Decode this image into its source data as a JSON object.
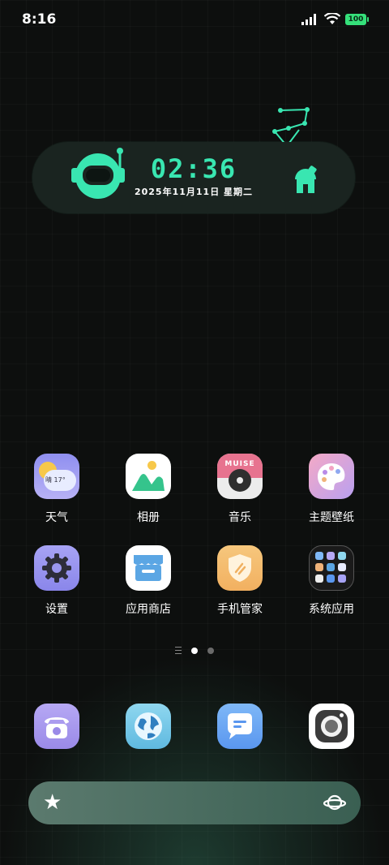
{
  "status_bar": {
    "time": "8:16",
    "battery": "100"
  },
  "clock_widget": {
    "time": "02:36",
    "date": "2025年11月11日 星期二"
  },
  "apps": [
    {
      "label": "天气",
      "icon": "weather-icon",
      "temp": "晴 17°"
    },
    {
      "label": "相册",
      "icon": "gallery-icon"
    },
    {
      "label": "音乐",
      "icon": "music-icon",
      "brand": "MUISE"
    },
    {
      "label": "主题壁纸",
      "icon": "theme-icon"
    },
    {
      "label": "设置",
      "icon": "settings-icon"
    },
    {
      "label": "应用商店",
      "icon": "app-store-icon"
    },
    {
      "label": "手机管家",
      "icon": "phone-manager-icon"
    },
    {
      "label": "系统应用",
      "icon": "system-apps-folder-icon"
    }
  ],
  "pagination": {
    "pages": 2,
    "current": 1
  },
  "dock": [
    {
      "icon": "phone-icon"
    },
    {
      "icon": "browser-icon"
    },
    {
      "icon": "messages-icon"
    },
    {
      "icon": "camera-icon"
    }
  ],
  "search_bar": {
    "left_icon": "star-icon",
    "right_icon": "planet-icon"
  }
}
